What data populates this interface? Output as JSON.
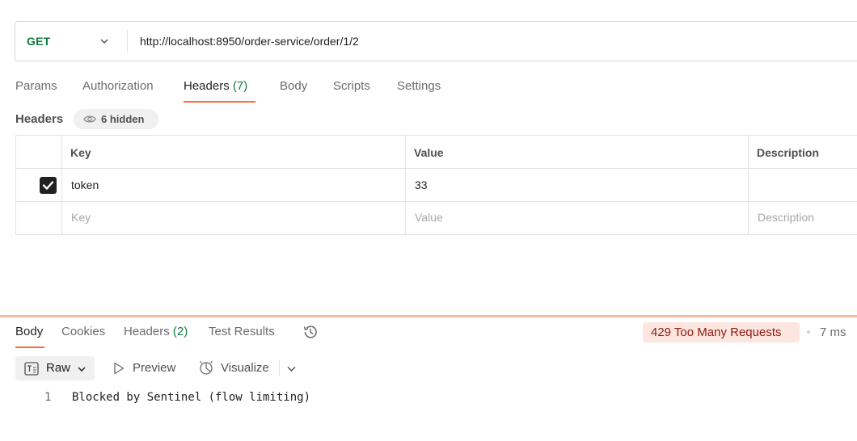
{
  "request": {
    "method": "GET",
    "url": "http://localhost:8950/order-service/order/1/2"
  },
  "request_tabs": [
    {
      "label": "Params"
    },
    {
      "label": "Authorization"
    },
    {
      "label": "Headers",
      "count": "(7)"
    },
    {
      "label": "Body"
    },
    {
      "label": "Scripts"
    },
    {
      "label": "Settings"
    }
  ],
  "headers_section": {
    "title": "Headers",
    "hidden_label": "6 hidden"
  },
  "headers_table": {
    "columns": [
      "Key",
      "Value",
      "Description"
    ],
    "rows": [
      {
        "checked": true,
        "key": "token",
        "value": "33",
        "description": ""
      }
    ],
    "placeholders": {
      "key": "Key",
      "value": "Value",
      "description": "Description"
    }
  },
  "response_tabs": [
    {
      "label": "Body"
    },
    {
      "label": "Cookies"
    },
    {
      "label": "Headers",
      "count": "(2)"
    },
    {
      "label": "Test Results"
    }
  ],
  "response_status": {
    "status": "429 Too Many Requests",
    "time": "7 ms"
  },
  "response_toolbar": {
    "format": "Raw",
    "preview": "Preview",
    "visualize": "Visualize"
  },
  "response_body": {
    "line_number": "1",
    "text": "Blocked by Sentinel (flow limiting)"
  },
  "colors": {
    "accent": "#ff6c37",
    "method_get": "#0b7d3a",
    "error_bg": "#fde5e0",
    "error_text": "#8e1a10"
  }
}
